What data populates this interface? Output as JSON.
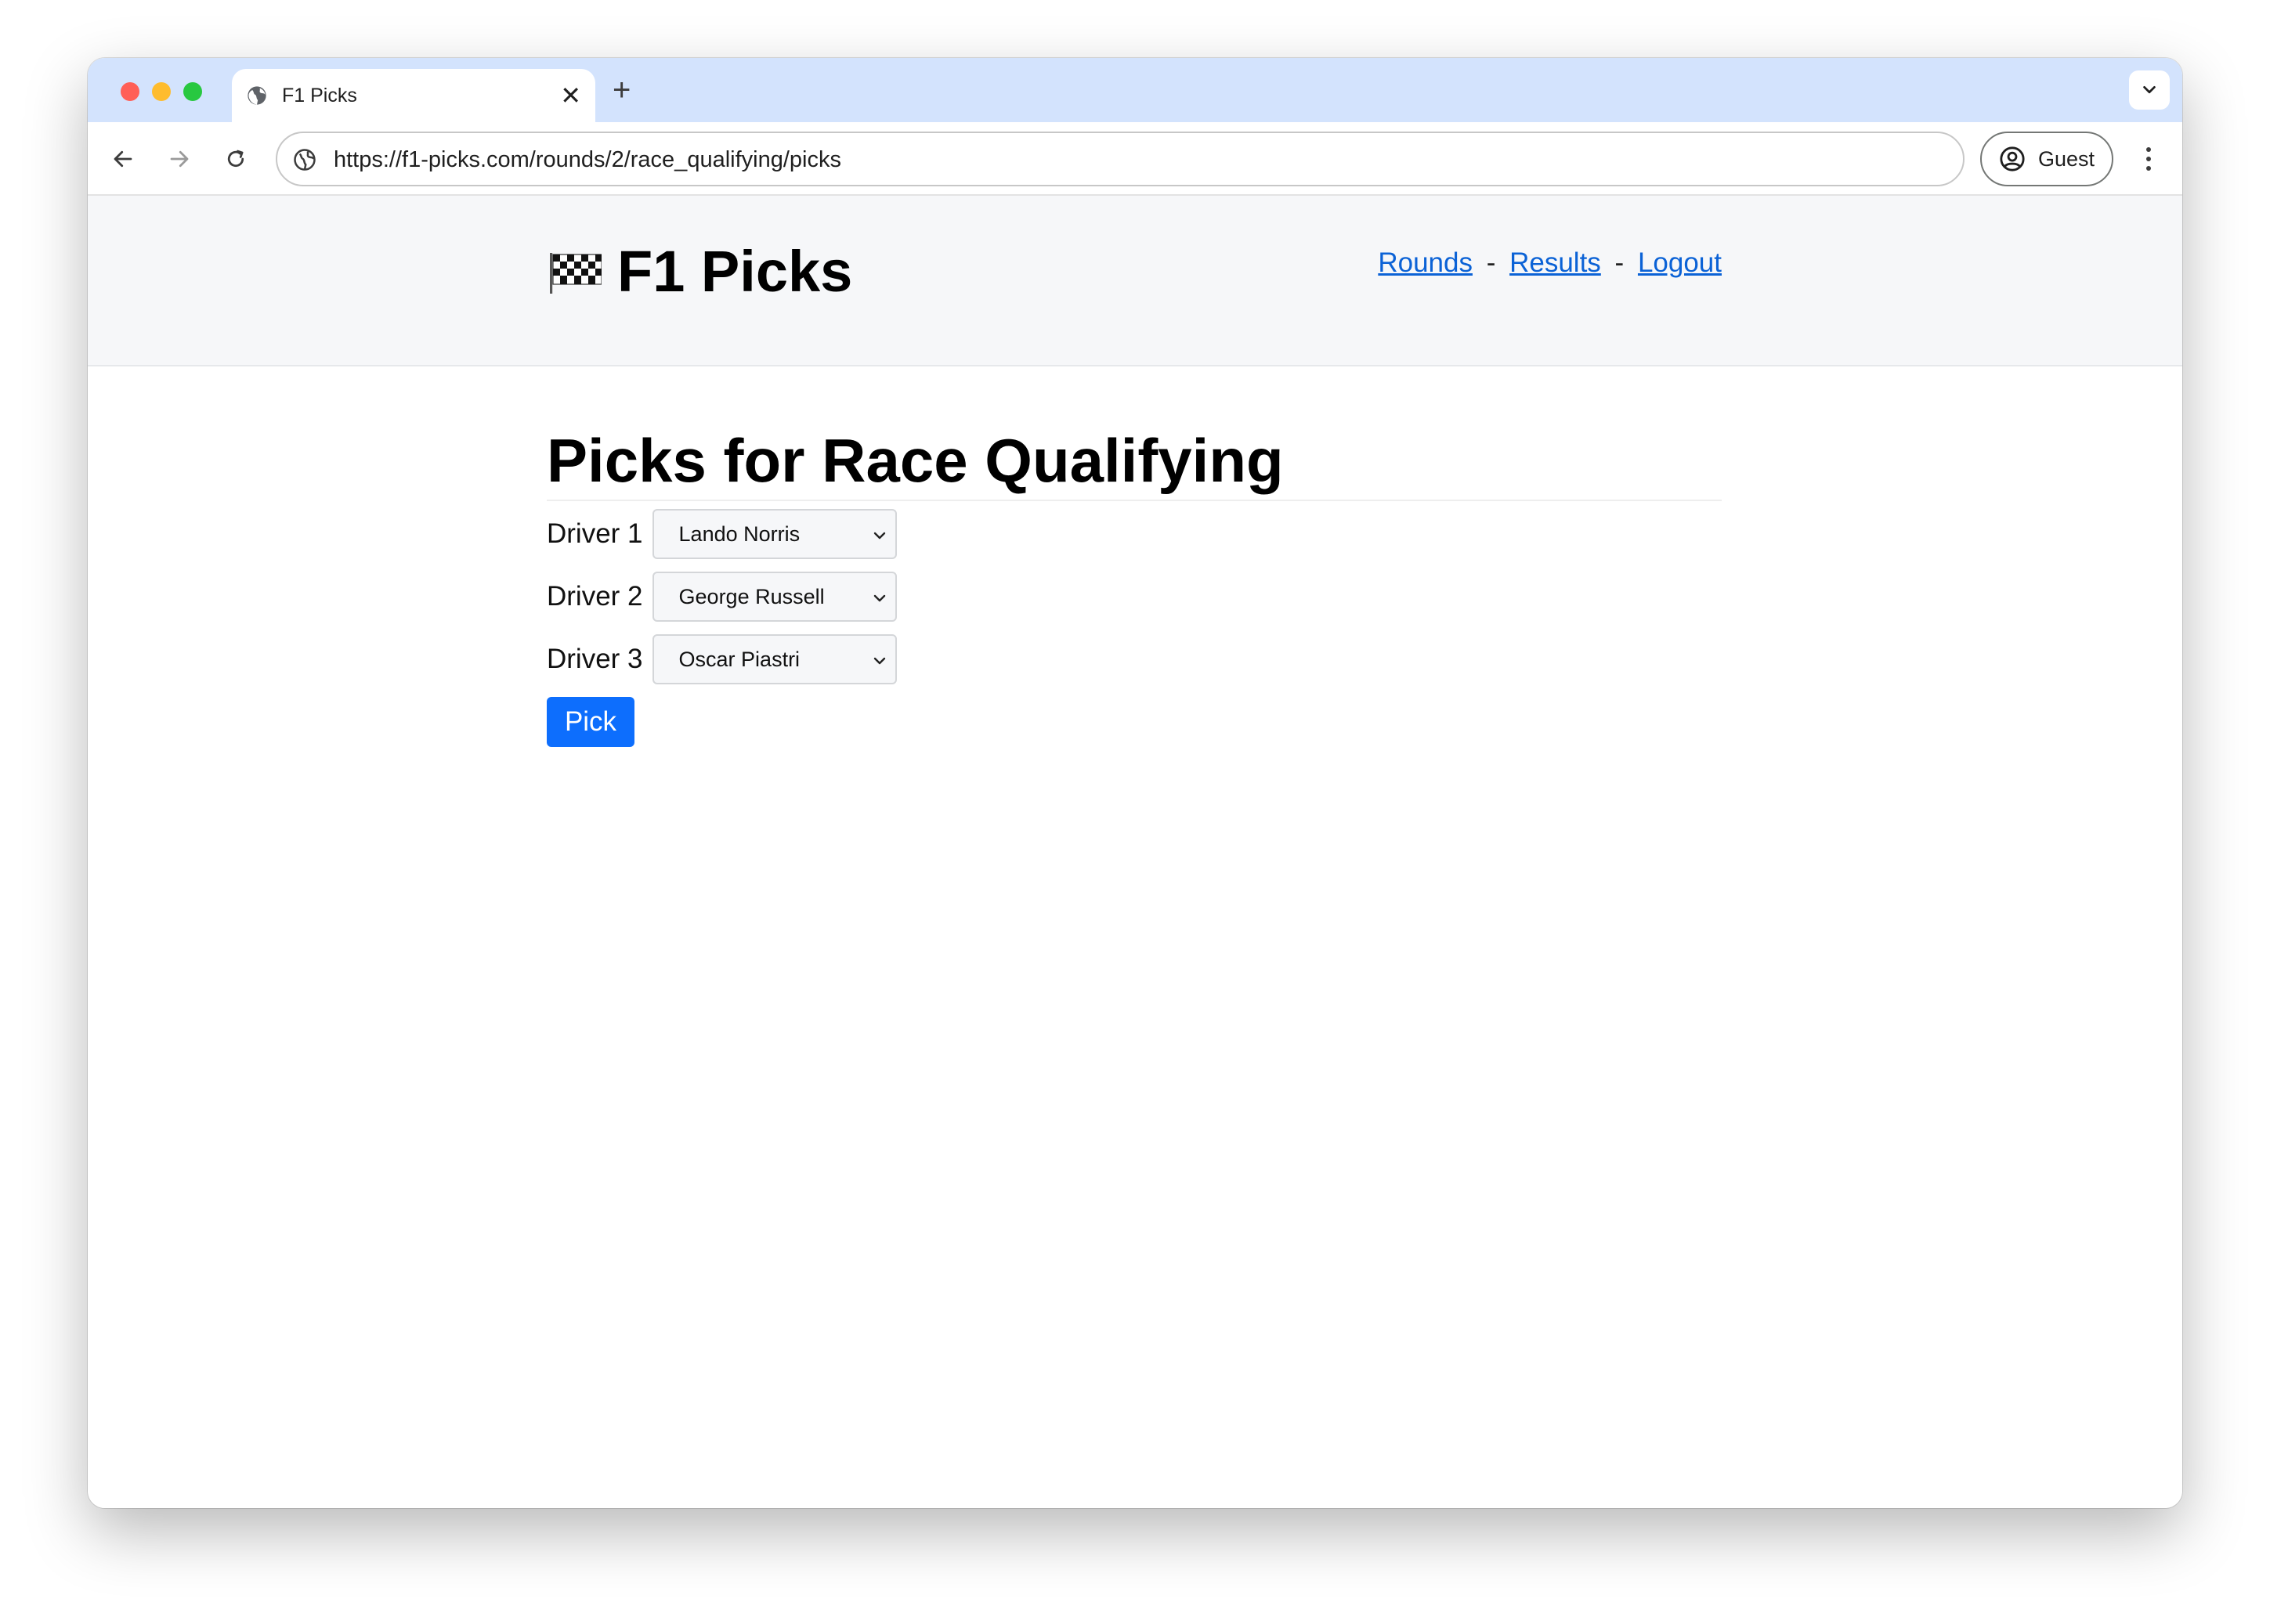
{
  "browser": {
    "tab_title": "F1 Picks",
    "tab_close": "✕",
    "new_tab": "+",
    "url": "https://f1-picks.com/rounds/2/race_qualifying/picks",
    "profile_label": "Guest"
  },
  "site": {
    "brand": "F1 Picks",
    "nav": {
      "rounds": "Rounds",
      "results": "Results",
      "logout": "Logout",
      "separator": "-"
    }
  },
  "main": {
    "title": "Picks for Race Qualifying",
    "fields": [
      {
        "label": "Driver 1",
        "value": "Lando Norris"
      },
      {
        "label": "Driver 2",
        "value": "George Russell"
      },
      {
        "label": "Driver 3",
        "value": "Oscar Piastri"
      }
    ],
    "submit_label": "Pick"
  },
  "colors": {
    "tab_strip": "#d3e3fd",
    "link": "#0b62d6",
    "button": "#0d6efd",
    "header_bg": "#f6f7f9"
  }
}
